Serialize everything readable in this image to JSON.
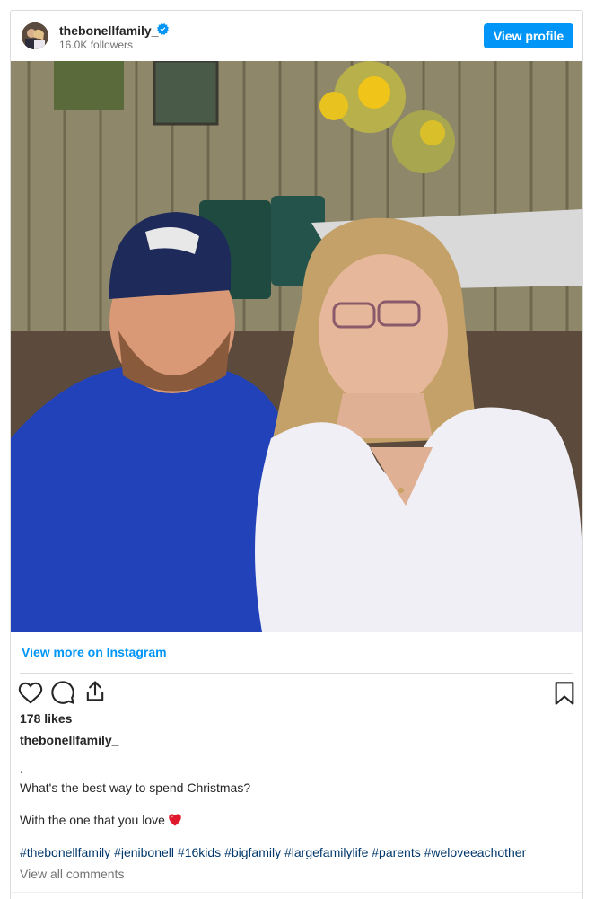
{
  "post": {
    "username": "thebonellfamily_",
    "followers": "16.0K followers",
    "view_profile_label": "View profile",
    "view_more_label": "View more on Instagram",
    "likes": "178 likes",
    "caption_username": "thebonellfamily_",
    "caption_dot": ".",
    "caption_line1": "What's the best way to spend Christmas?",
    "caption_line2": "With the one that you love",
    "hashtags": [
      "#thebonellfamily",
      "#jenibonell",
      "#16kids",
      "#bigfamily",
      "#largefamilylife",
      "#parents",
      "#weloveeachother"
    ],
    "view_all_comments": "View all comments"
  },
  "icons": {
    "verified": "verified-badge-icon",
    "like": "heart-outline-icon",
    "comment": "comment-bubble-icon",
    "share": "share-upload-icon",
    "save": "bookmark-icon",
    "emoji": "red-heart-emoji"
  },
  "colors": {
    "primary_button": "#0095f6",
    "hashtag": "#00376b",
    "secondary_text": "#737373",
    "heart_emoji": "#e0182d"
  },
  "hashtag_sep": " "
}
